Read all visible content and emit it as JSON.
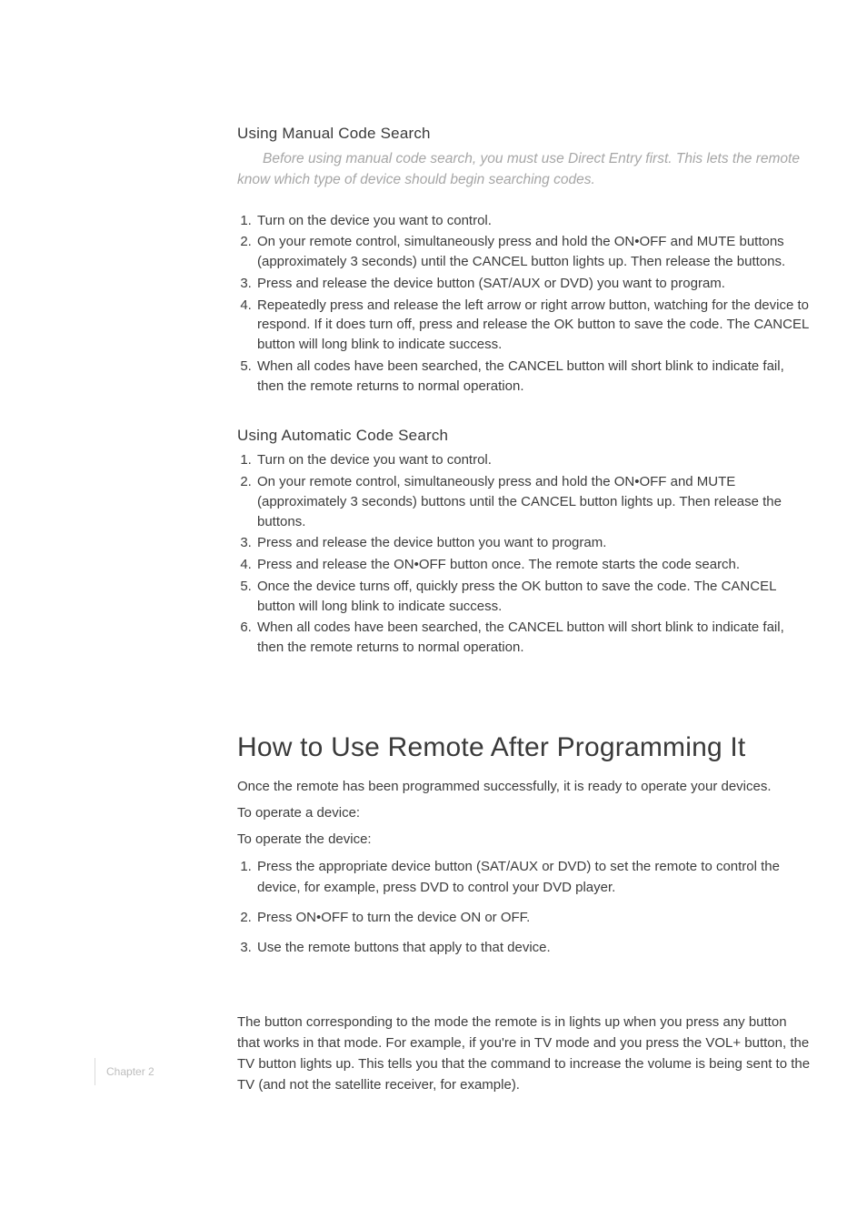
{
  "sections": {
    "manual": {
      "heading": "Using Manual Code Search",
      "note": "Before using manual code search, you must use Direct Entry first. This lets the remote know which type of device should begin searching codes.",
      "steps": [
        "Turn on the device you want to control.",
        "On your remote control, simultaneously press and hold the ON•OFF and MUTE buttons (approximately 3 seconds) until the CANCEL button lights up. Then release the buttons.",
        "Press and release the device button (SAT/AUX or DVD) you want to program.",
        "Repeatedly press and release the left arrow or right arrow button, watching for the device to respond. If it does turn off, press and release the OK button to save the code. The CANCEL button will long blink to indicate success.",
        "When all codes have been searched, the CANCEL button will short blink to indicate fail, then the remote returns to normal operation."
      ]
    },
    "auto": {
      "heading": "Using Automatic Code Search",
      "steps": [
        "Turn on the device you want to control.",
        "On your remote control, simultaneously press and hold the ON•OFF and MUTE (approximately 3 seconds) buttons until the CANCEL button lights up. Then release the buttons.",
        "Press and release the device button you want to program.",
        "Press and release the ON•OFF button once.  The remote starts the code search.",
        "Once the device turns off, quickly press the OK button to save the code.  The CANCEL button will long blink to indicate success.",
        "When all codes have been searched, the CANCEL button will short blink to indicate fail, then the remote returns to normal operation."
      ]
    },
    "howto": {
      "h1": "How to Use Remote After Programming It",
      "p1": "Once the remote has been programmed successfully, it is ready to operate your devices.",
      "p2": "To operate a device:",
      "p3": "To operate the device:",
      "steps": [
        "Press the appropriate device button (SAT/AUX or DVD) to set the remote to control the device, for example, press DVD to control your DVD player.",
        "Press ON•OFF to turn the device ON or OFF.",
        "Use the remote buttons that apply to that device."
      ],
      "p4": "The button corresponding to the mode the remote is in lights up when you press any button that works in that mode. For example, if you're in TV mode and you press the VOL+ button, the TV button lights up. This tells you that the command to increase the volume is being sent to the TV (and not the satellite receiver, for example)."
    }
  },
  "footer": {
    "chapter": "Chapter 2"
  }
}
